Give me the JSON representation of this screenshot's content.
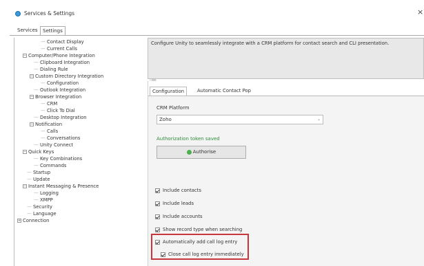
{
  "window": {
    "title": "Services & Settings",
    "close_glyph": "×",
    "icon": "app-icon"
  },
  "tabs": [
    {
      "label": "Services",
      "active": false
    },
    {
      "label": "Settings",
      "active": true
    }
  ],
  "tree": {
    "scroll_up_glyph": "▲",
    "nodes": [
      {
        "label": "Contact Display",
        "expander": ""
      },
      {
        "label": "Current Calls",
        "expander": ""
      },
      {
        "label": "Computer/Phone Integration",
        "expander": "−"
      },
      {
        "label": "Clipboard Integration",
        "expander": ""
      },
      {
        "label": "Dialing Rule",
        "expander": ""
      },
      {
        "label": "Custom Directory Integration",
        "expander": "−"
      },
      {
        "label": "Configuration",
        "expander": ""
      },
      {
        "label": "Outlook Integration",
        "expander": ""
      },
      {
        "label": "Browser Integration",
        "expander": "−"
      },
      {
        "label": "CRM",
        "expander": ""
      },
      {
        "label": "Click To Dial",
        "expander": ""
      },
      {
        "label": "Desktop Integration",
        "expander": ""
      },
      {
        "label": "Notification",
        "expander": "−"
      },
      {
        "label": "Calls",
        "expander": ""
      },
      {
        "label": "Conversations",
        "expander": ""
      },
      {
        "label": "Unity Connect",
        "expander": ""
      },
      {
        "label": "Quick Keys",
        "expander": "−"
      },
      {
        "label": "Key Combinations",
        "expander": ""
      },
      {
        "label": "Commands",
        "expander": ""
      },
      {
        "label": "Startup",
        "expander": ""
      },
      {
        "label": "Update",
        "expander": ""
      },
      {
        "label": "Instant Messaging & Presence",
        "expander": "−"
      },
      {
        "label": "Logging",
        "expander": ""
      },
      {
        "label": "XMPP",
        "expander": ""
      },
      {
        "label": "Security",
        "expander": ""
      },
      {
        "label": "Language",
        "expander": ""
      },
      {
        "label": "Connection",
        "expander": "+"
      }
    ]
  },
  "description": "Configure Unity to seamlessly integrate with a CRM platform for contact search and CLI presentation.",
  "subtabs": [
    {
      "label": "Configuration",
      "active": true
    },
    {
      "label": "Automatic Contact Pop",
      "active": false
    }
  ],
  "config": {
    "crm_platform_label": "CRM Platform",
    "crm_platform_value": "Zoho",
    "dropdown_glyph": "⌄",
    "auth_status": "Authorization token saved",
    "authorise_button": "Authorise",
    "checkboxes": [
      {
        "label": "Include contacts",
        "checked": true
      },
      {
        "label": "Include leads",
        "checked": true
      },
      {
        "label": "Include accounts",
        "checked": true
      },
      {
        "label": "Show record type when searching",
        "checked": true
      },
      {
        "label": "Automatically add call log entry",
        "checked": true
      },
      {
        "label": "Close call log entry immediately",
        "checked": true
      }
    ]
  },
  "colors": {
    "highlight_border": "#c7353d",
    "status_green": "#2e8b3a",
    "accent": "#3b9ad9"
  }
}
